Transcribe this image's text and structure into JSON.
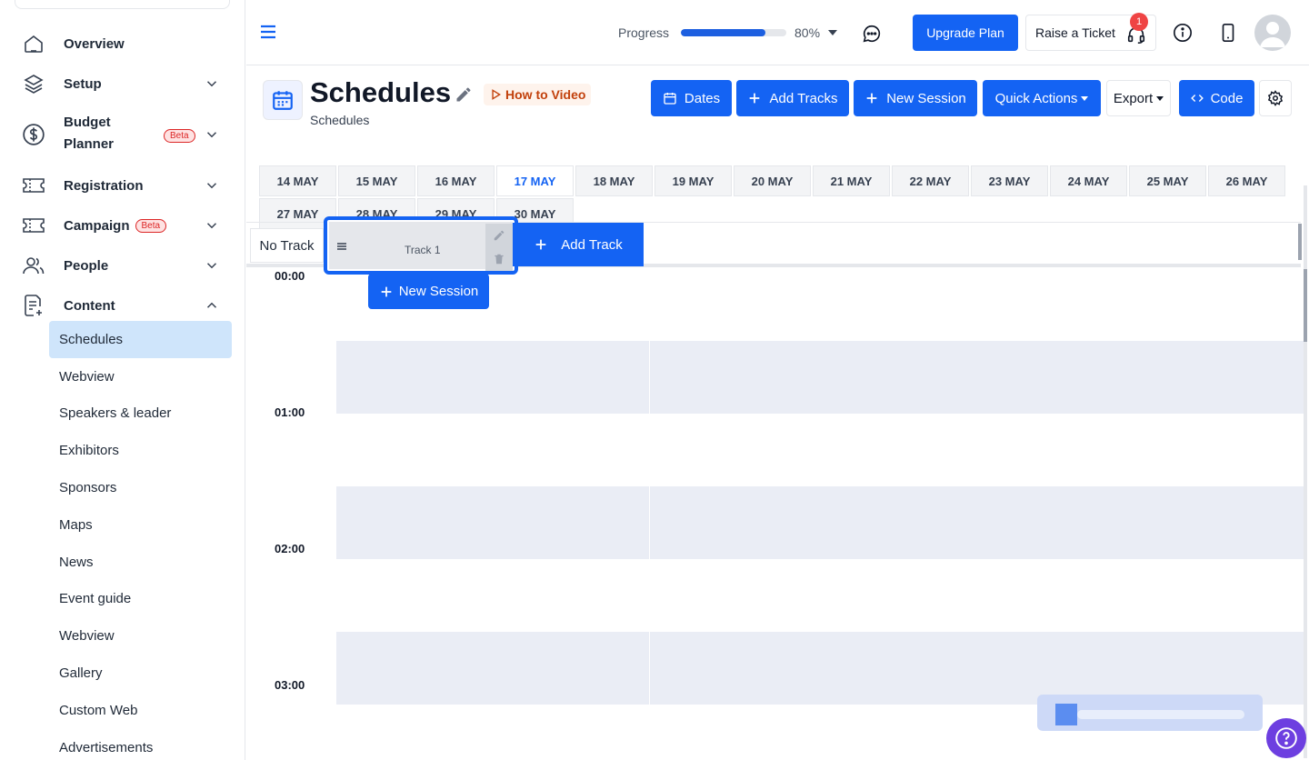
{
  "sidebar": {
    "items": [
      {
        "label": "Overview",
        "icon": "home-icon"
      },
      {
        "label": "Setup",
        "icon": "layers-icon"
      },
      {
        "label_line1": "Budget",
        "label_line2": "Planner",
        "badge": "Beta",
        "icon": "dollar-icon"
      },
      {
        "label": "Registration",
        "icon": "ticket-icon"
      },
      {
        "label": "Campaign",
        "badge": "Beta",
        "icon": "ticket-icon"
      },
      {
        "label": "People",
        "icon": "users-icon"
      },
      {
        "label": "Content",
        "icon": "document-icon"
      }
    ],
    "content_sub": [
      "Schedules",
      "Webview",
      "Speakers & leader",
      "Exhibitors",
      "Sponsors",
      "Maps",
      "News",
      "Event guide",
      "Webview",
      "Gallery",
      "Custom Web",
      "Advertisements"
    ]
  },
  "topbar": {
    "progress_label": "Progress",
    "progress_value": 0.8,
    "progress_text": "80%",
    "upgrade_label": "Upgrade Plan",
    "ticket_label": "Raise a Ticket",
    "notification_count": "1"
  },
  "header": {
    "title": "Schedules",
    "subtitle": "Schedules",
    "how_to": "How to Video",
    "buttons": {
      "dates": "Dates",
      "add_tracks": "Add Tracks",
      "new_session": "New Session",
      "quick_actions": "Quick Actions",
      "export": "Export",
      "code": "Code"
    }
  },
  "dates": {
    "row1": [
      "14 MAY",
      "15 MAY",
      "16 MAY",
      "17 MAY",
      "18 MAY",
      "19 MAY",
      "20 MAY",
      "21 MAY",
      "22 MAY",
      "23 MAY",
      "24 MAY",
      "25 MAY",
      "26 MAY"
    ],
    "row2": [
      "27 MAY",
      "28 MAY",
      "29 MAY",
      "30 MAY"
    ],
    "active": "17 MAY"
  },
  "tracks": {
    "no_track": "No Track",
    "track1": "Track 1",
    "add_track": "Add Track",
    "new_session": "New Session"
  },
  "times": [
    "00:00",
    "01:00",
    "02:00",
    "03:00"
  ],
  "colors": {
    "primary": "#1463f3",
    "active_sidebar": "#cfe5fb",
    "grid_band": "#eaedf5"
  }
}
